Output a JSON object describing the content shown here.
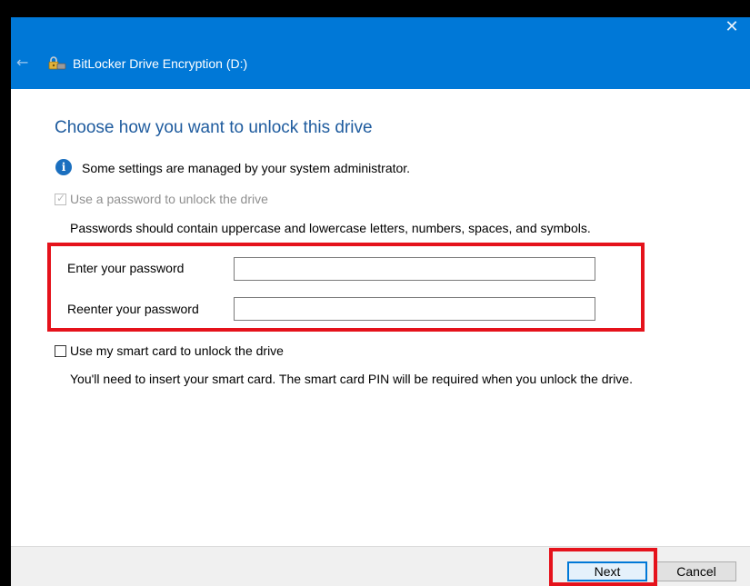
{
  "window": {
    "title": "BitLocker Drive Encryption (D:)",
    "close_glyph": "✕",
    "back_glyph": "←",
    "accent_color": "#0078d7"
  },
  "page": {
    "heading": "Choose how you want to unlock this drive",
    "info_text": "Some settings are managed by your system administrator.",
    "password_option": {
      "label": "Use a password to unlock the drive",
      "checked": true,
      "disabled": true,
      "hint": "Passwords should contain uppercase and lowercase letters, numbers, spaces, and symbols.",
      "enter_label": "Enter your password",
      "enter_value": "",
      "reenter_label": "Reenter your password",
      "reenter_value": ""
    },
    "smartcard_option": {
      "label": "Use my smart card to unlock the drive",
      "checked": false,
      "hint": "You'll need to insert your smart card. The smart card PIN will be required when you unlock the drive."
    }
  },
  "footer": {
    "next_label": "Next",
    "cancel_label": "Cancel"
  },
  "annotations": {
    "highlight_color": "#e5121b"
  }
}
